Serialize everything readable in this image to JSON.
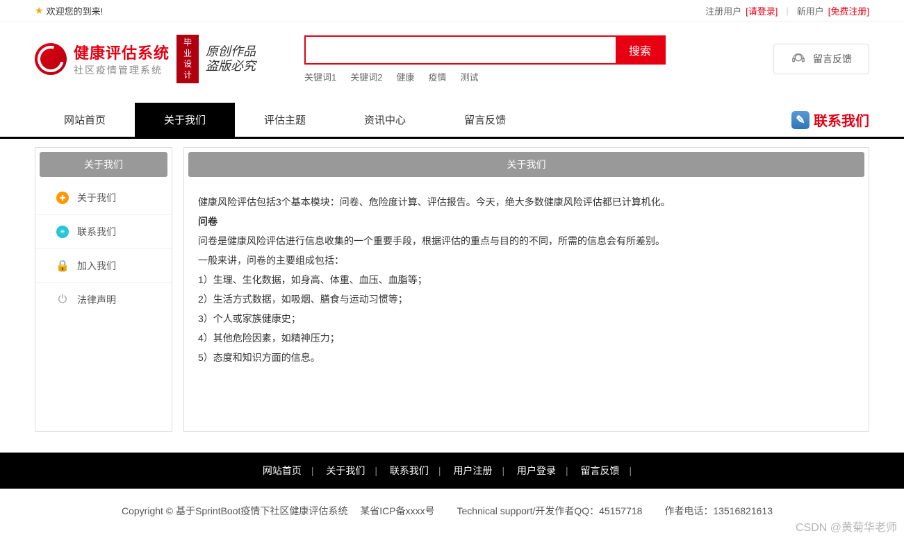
{
  "topbar": {
    "welcome": "欢迎您的到来!",
    "registered_label": "注册用户",
    "login_link": "[请登录]",
    "new_user_label": "新用户",
    "register_link": "[免费注册]"
  },
  "logo": {
    "title": "健康评估系统",
    "subtitle": "社区疫情管理系统",
    "badge_line1": "毕业",
    "badge_line2": "设计",
    "calligraphy_line1": "原创作品",
    "calligraphy_line2": "盗版必究"
  },
  "search": {
    "button": "搜索",
    "placeholder": "",
    "keywords": [
      "关键词1",
      "关键词2",
      "健康",
      "疫情",
      "测试"
    ]
  },
  "feedback_button": "留言反馈",
  "nav": {
    "items": [
      "网站首页",
      "关于我们",
      "评估主题",
      "资讯中心",
      "留言反馈"
    ],
    "active_index": 1,
    "contact": "联系我们"
  },
  "sidebar": {
    "title": "关于我们",
    "items": [
      {
        "label": "关于我们",
        "icon": "plus-orange"
      },
      {
        "label": "联系我们",
        "icon": "doc-teal"
      },
      {
        "label": "加入我们",
        "icon": "lock-red"
      },
      {
        "label": "法律声明",
        "icon": "power-gray"
      }
    ]
  },
  "content": {
    "title": "关于我们",
    "paragraphs": [
      {
        "text": "健康风险评估包括3个基本模块：问卷、危险度计算、评估报告。今天，绝大多数健康风险评估都已计算机化。",
        "bold": false
      },
      {
        "text": "问卷",
        "bold": true
      },
      {
        "text": "问卷是健康风险评估进行信息收集的一个重要手段，根据评估的重点与目的的不同，所需的信息会有所差别。",
        "bold": false
      },
      {
        "text": "一般来讲，问卷的主要组成包括：",
        "bold": false
      },
      {
        "text": "1）生理、生化数据，如身高、体重、血压、血脂等；",
        "bold": false
      },
      {
        "text": "2）生活方式数据，如吸烟、膳食与运动习惯等；",
        "bold": false
      },
      {
        "text": "3）个人或家族健康史；",
        "bold": false
      },
      {
        "text": "4）其他危险因素，如精神压力；",
        "bold": false
      },
      {
        "text": "5）态度和知识方面的信息。",
        "bold": false
      }
    ]
  },
  "footer": {
    "nav": [
      "网站首页",
      "关于我们",
      "联系我们",
      "用户注册",
      "用户登录",
      "留言反馈"
    ],
    "copyright_prefix": "Copyright © 基于SprintBoot疫情下社区健康评估系统",
    "icp": "某省ICP备xxxx号",
    "technical": "Technical support/开发作者QQ：45157718",
    "author_phone": "作者电话：13516821613"
  },
  "watermark": "CSDN @黄菊华老师"
}
